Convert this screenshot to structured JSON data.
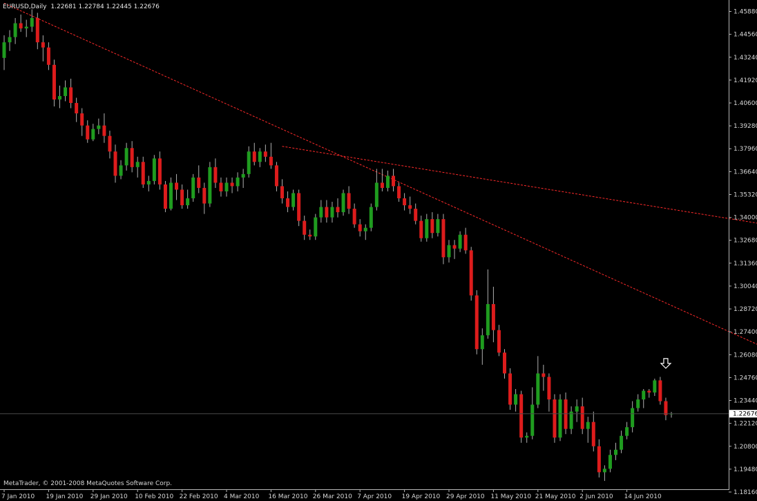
{
  "header": {
    "symbol": "EURUSD,Daily",
    "ohlc": "1.22681 1.22784 1.22445 1.22676"
  },
  "footer": {
    "copyright": "MetaTrader, © 2001-2008 MetaQuotes Software Corp."
  },
  "colors": {
    "background": "#000000",
    "bull": "#1f9c1f",
    "bear": "#dd1c1c",
    "axis": "#b8b8b8",
    "grid": "#1a1a1a",
    "trendline": "#ff2a2a",
    "price_line": "#4a4a4a"
  },
  "chart_data": {
    "type": "candlestick",
    "y_ticks": [
      "1.45880",
      "1.44560",
      "1.43240",
      "1.41920",
      "1.40600",
      "1.39280",
      "1.37960",
      "1.36640",
      "1.35320",
      "1.34000",
      "1.32680",
      "1.31360",
      "1.30040",
      "1.28720",
      "1.27400",
      "1.26080",
      "1.24760",
      "1.23440",
      "1.22120",
      "1.20800",
      "1.19480",
      "1.18160"
    ],
    "ylim": [
      1.1816,
      1.4638
    ],
    "x_ticks": [
      {
        "i": 0,
        "label": "7 Jan 2010"
      },
      {
        "i": 8,
        "label": "19 Jan 2010"
      },
      {
        "i": 16,
        "label": "29 Jan 2010"
      },
      {
        "i": 24,
        "label": "10 Feb 2010"
      },
      {
        "i": 32,
        "label": "22 Feb 2010"
      },
      {
        "i": 40,
        "label": "4 Mar 2010"
      },
      {
        "i": 48,
        "label": "16 Mar 2010"
      },
      {
        "i": 56,
        "label": "26 Mar 2010"
      },
      {
        "i": 64,
        "label": "7 Apr 2010"
      },
      {
        "i": 72,
        "label": "19 Apr 2010"
      },
      {
        "i": 80,
        "label": "29 Apr 2010"
      },
      {
        "i": 88,
        "label": "11 May 2010"
      },
      {
        "i": 96,
        "label": "21 May 2010"
      },
      {
        "i": 104,
        "label": "2 Jun 2010"
      },
      {
        "i": 112,
        "label": "14 Jun 2010"
      }
    ],
    "current_price": "1.22676",
    "current_value": 1.22676,
    "ohlc": [
      [
        1.432,
        1.445,
        1.425,
        1.441
      ],
      [
        1.441,
        1.448,
        1.436,
        1.444
      ],
      [
        1.444,
        1.455,
        1.44,
        1.452
      ],
      [
        1.452,
        1.457,
        1.447,
        1.449
      ],
      [
        1.449,
        1.454,
        1.444,
        1.45
      ],
      [
        1.45,
        1.46,
        1.447,
        1.455
      ],
      [
        1.455,
        1.458,
        1.437,
        1.441
      ],
      [
        1.441,
        1.445,
        1.43,
        1.438
      ],
      [
        1.438,
        1.441,
        1.425,
        1.428
      ],
      [
        1.428,
        1.431,
        1.404,
        1.408
      ],
      [
        1.408,
        1.416,
        1.403,
        1.41
      ],
      [
        1.41,
        1.419,
        1.407,
        1.415
      ],
      [
        1.415,
        1.42,
        1.403,
        1.406
      ],
      [
        1.406,
        1.409,
        1.395,
        1.4
      ],
      [
        1.4,
        1.403,
        1.387,
        1.393
      ],
      [
        1.393,
        1.396,
        1.383,
        1.385
      ],
      [
        1.385,
        1.394,
        1.384,
        1.391
      ],
      [
        1.391,
        1.397,
        1.388,
        1.393
      ],
      [
        1.393,
        1.4,
        1.383,
        1.387
      ],
      [
        1.387,
        1.39,
        1.374,
        1.378
      ],
      [
        1.378,
        1.382,
        1.36,
        1.364
      ],
      [
        1.364,
        1.373,
        1.362,
        1.37
      ],
      [
        1.37,
        1.383,
        1.367,
        1.38
      ],
      [
        1.38,
        1.384,
        1.366,
        1.369
      ],
      [
        1.369,
        1.375,
        1.363,
        1.372
      ],
      [
        1.372,
        1.375,
        1.357,
        1.359
      ],
      [
        1.359,
        1.364,
        1.355,
        1.361
      ],
      [
        1.361,
        1.376,
        1.359,
        1.374
      ],
      [
        1.374,
        1.378,
        1.356,
        1.359
      ],
      [
        1.359,
        1.361,
        1.343,
        1.345
      ],
      [
        1.345,
        1.363,
        1.344,
        1.36
      ],
      [
        1.36,
        1.365,
        1.35,
        1.356
      ],
      [
        1.356,
        1.359,
        1.345,
        1.347
      ],
      [
        1.347,
        1.356,
        1.345,
        1.351
      ],
      [
        1.351,
        1.365,
        1.349,
        1.363
      ],
      [
        1.363,
        1.37,
        1.354,
        1.357
      ],
      [
        1.357,
        1.36,
        1.342,
        1.348
      ],
      [
        1.348,
        1.372,
        1.346,
        1.369
      ],
      [
        1.369,
        1.374,
        1.357,
        1.36
      ],
      [
        1.36,
        1.363,
        1.352,
        1.355
      ],
      [
        1.355,
        1.363,
        1.352,
        1.36
      ],
      [
        1.36,
        1.363,
        1.354,
        1.358
      ],
      [
        1.358,
        1.366,
        1.355,
        1.363
      ],
      [
        1.363,
        1.368,
        1.357,
        1.365
      ],
      [
        1.365,
        1.381,
        1.363,
        1.378
      ],
      [
        1.378,
        1.383,
        1.37,
        1.372
      ],
      [
        1.372,
        1.38,
        1.369,
        1.378
      ],
      [
        1.378,
        1.382,
        1.372,
        1.375
      ],
      [
        1.375,
        1.383,
        1.368,
        1.37
      ],
      [
        1.37,
        1.372,
        1.355,
        1.358
      ],
      [
        1.358,
        1.362,
        1.348,
        1.351
      ],
      [
        1.351,
        1.355,
        1.343,
        1.346
      ],
      [
        1.346,
        1.356,
        1.344,
        1.354
      ],
      [
        1.354,
        1.356,
        1.335,
        1.338
      ],
      [
        1.338,
        1.341,
        1.327,
        1.33
      ],
      [
        1.33,
        1.333,
        1.327,
        1.329
      ],
      [
        1.329,
        1.342,
        1.327,
        1.34
      ],
      [
        1.34,
        1.35,
        1.337,
        1.346
      ],
      [
        1.346,
        1.35,
        1.337,
        1.34
      ],
      [
        1.34,
        1.349,
        1.337,
        1.346
      ],
      [
        1.346,
        1.351,
        1.34,
        1.343
      ],
      [
        1.343,
        1.356,
        1.341,
        1.354
      ],
      [
        1.354,
        1.358,
        1.342,
        1.345
      ],
      [
        1.345,
        1.348,
        1.334,
        1.336
      ],
      [
        1.336,
        1.339,
        1.329,
        1.332
      ],
      [
        1.332,
        1.336,
        1.327,
        1.334
      ],
      [
        1.334,
        1.348,
        1.332,
        1.346
      ],
      [
        1.346,
        1.368,
        1.344,
        1.36
      ],
      [
        1.36,
        1.368,
        1.355,
        1.357
      ],
      [
        1.357,
        1.367,
        1.355,
        1.364
      ],
      [
        1.364,
        1.368,
        1.355,
        1.358
      ],
      [
        1.358,
        1.36,
        1.349,
        1.351
      ],
      [
        1.351,
        1.354,
        1.344,
        1.347
      ],
      [
        1.347,
        1.352,
        1.342,
        1.345
      ],
      [
        1.345,
        1.348,
        1.336,
        1.338
      ],
      [
        1.338,
        1.341,
        1.326,
        1.328
      ],
      [
        1.328,
        1.342,
        1.326,
        1.339
      ],
      [
        1.339,
        1.343,
        1.328,
        1.331
      ],
      [
        1.331,
        1.342,
        1.329,
        1.339
      ],
      [
        1.339,
        1.342,
        1.313,
        1.317
      ],
      [
        1.317,
        1.327,
        1.314,
        1.324
      ],
      [
        1.324,
        1.327,
        1.316,
        1.322
      ],
      [
        1.322,
        1.332,
        1.32,
        1.33
      ],
      [
        1.33,
        1.334,
        1.319,
        1.321
      ],
      [
        1.321,
        1.323,
        1.292,
        1.295
      ],
      [
        1.295,
        1.298,
        1.261,
        1.264
      ],
      [
        1.264,
        1.276,
        1.255,
        1.272
      ],
      [
        1.272,
        1.31,
        1.27,
        1.29
      ],
      [
        1.29,
        1.3,
        1.268,
        1.275
      ],
      [
        1.275,
        1.278,
        1.26,
        1.262
      ],
      [
        1.262,
        1.264,
        1.247,
        1.25
      ],
      [
        1.25,
        1.253,
        1.229,
        1.232
      ],
      [
        1.232,
        1.241,
        1.228,
        1.238
      ],
      [
        1.238,
        1.24,
        1.21,
        1.213
      ],
      [
        1.213,
        1.216,
        1.21,
        1.214
      ],
      [
        1.214,
        1.242,
        1.212,
        1.232
      ],
      [
        1.232,
        1.26,
        1.23,
        1.25
      ],
      [
        1.25,
        1.255,
        1.24,
        1.248
      ],
      [
        1.248,
        1.25,
        1.228,
        1.235
      ],
      [
        1.235,
        1.238,
        1.21,
        1.213
      ],
      [
        1.213,
        1.238,
        1.211,
        1.235
      ],
      [
        1.235,
        1.239,
        1.215,
        1.218
      ],
      [
        1.218,
        1.231,
        1.215,
        1.228
      ],
      [
        1.228,
        1.235,
        1.222,
        1.231
      ],
      [
        1.231,
        1.236,
        1.215,
        1.218
      ],
      [
        1.218,
        1.225,
        1.21,
        1.222
      ],
      [
        1.222,
        1.228,
        1.205,
        1.208
      ],
      [
        1.208,
        1.212,
        1.19,
        1.193
      ],
      [
        1.193,
        1.197,
        1.188,
        1.195
      ],
      [
        1.195,
        1.206,
        1.193,
        1.203
      ],
      [
        1.203,
        1.21,
        1.2,
        1.206
      ],
      [
        1.206,
        1.217,
        1.204,
        1.214
      ],
      [
        1.214,
        1.222,
        1.212,
        1.219
      ],
      [
        1.219,
        1.234,
        1.216,
        1.23
      ],
      [
        1.23,
        1.238,
        1.228,
        1.235
      ],
      [
        1.235,
        1.241,
        1.23,
        1.24
      ],
      [
        1.24,
        1.241,
        1.236,
        1.239
      ],
      [
        1.239,
        1.247,
        1.237,
        1.246
      ],
      [
        1.246,
        1.248,
        1.232,
        1.234
      ],
      [
        1.234,
        1.236,
        1.223,
        1.226
      ],
      [
        1.2268,
        1.2278,
        1.2245,
        1.2268
      ]
    ],
    "trendlines": [
      {
        "from": [
          0,
          1.4635
        ],
        "to": [
          158,
          1.234
        ]
      },
      {
        "from": [
          50,
          1.381
        ],
        "to": [
          158,
          1.325
        ]
      }
    ],
    "marker": {
      "type": "arrow-down",
      "at": 119,
      "value": 1.253
    }
  }
}
